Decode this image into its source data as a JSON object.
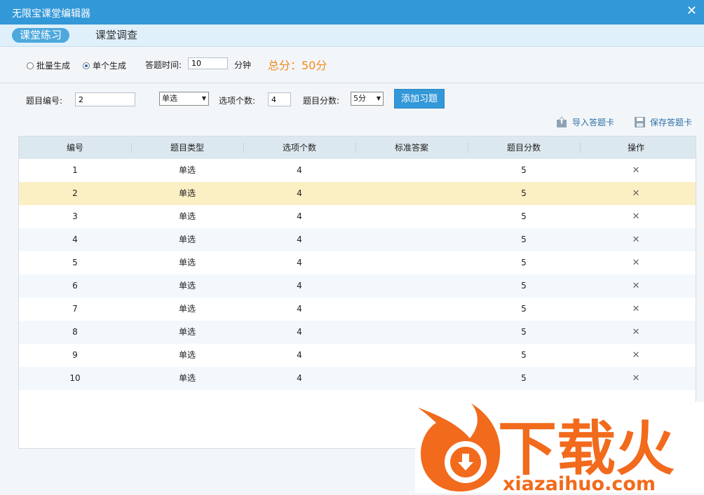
{
  "window": {
    "title": "无限宝课堂编辑器",
    "close_glyph": "✕"
  },
  "tabs": [
    {
      "label": "课堂练习",
      "active": true
    },
    {
      "label": "课堂调查",
      "active": false
    }
  ],
  "generate": {
    "batch_label": "批量生成",
    "single_label": "单个生成",
    "selected": "single",
    "time_label": "答题时间:",
    "time_value": "10",
    "time_unit": "分钟",
    "total": "总分：50分"
  },
  "question_form": {
    "number_label": "题目编号:",
    "number_value": "2",
    "type_value": "单选",
    "options_label": "选项个数:",
    "options_value": "4",
    "score_label": "题目分数:",
    "score_value": "5分",
    "add_button": "添加习题"
  },
  "toolbar": {
    "import_label": "导入答题卡",
    "save_label": "保存答题卡"
  },
  "table": {
    "headers": [
      "编号",
      "题目类型",
      "选项个数",
      "标准答案",
      "题目分数",
      "操作"
    ],
    "rows": [
      [
        "1",
        "单选",
        "4",
        "",
        "5"
      ],
      [
        "2",
        "单选",
        "4",
        "",
        "5"
      ],
      [
        "3",
        "单选",
        "4",
        "",
        "5"
      ],
      [
        "4",
        "单选",
        "4",
        "",
        "5"
      ],
      [
        "5",
        "单选",
        "4",
        "",
        "5"
      ],
      [
        "6",
        "单选",
        "4",
        "",
        "5"
      ],
      [
        "7",
        "单选",
        "4",
        "",
        "5"
      ],
      [
        "8",
        "单选",
        "4",
        "",
        "5"
      ],
      [
        "9",
        "单选",
        "4",
        "",
        "5"
      ],
      [
        "10",
        "单选",
        "4",
        "",
        "5"
      ]
    ],
    "delete_glyph": "✕",
    "highlight_row": 1
  },
  "watermark": {
    "text": "下载火",
    "url": "xiazaihuo.com"
  },
  "colors": {
    "accent": "#3398d8",
    "total": "#f08a1c",
    "highlight": "#fbefc4",
    "stripe": "#f3f8fc"
  }
}
